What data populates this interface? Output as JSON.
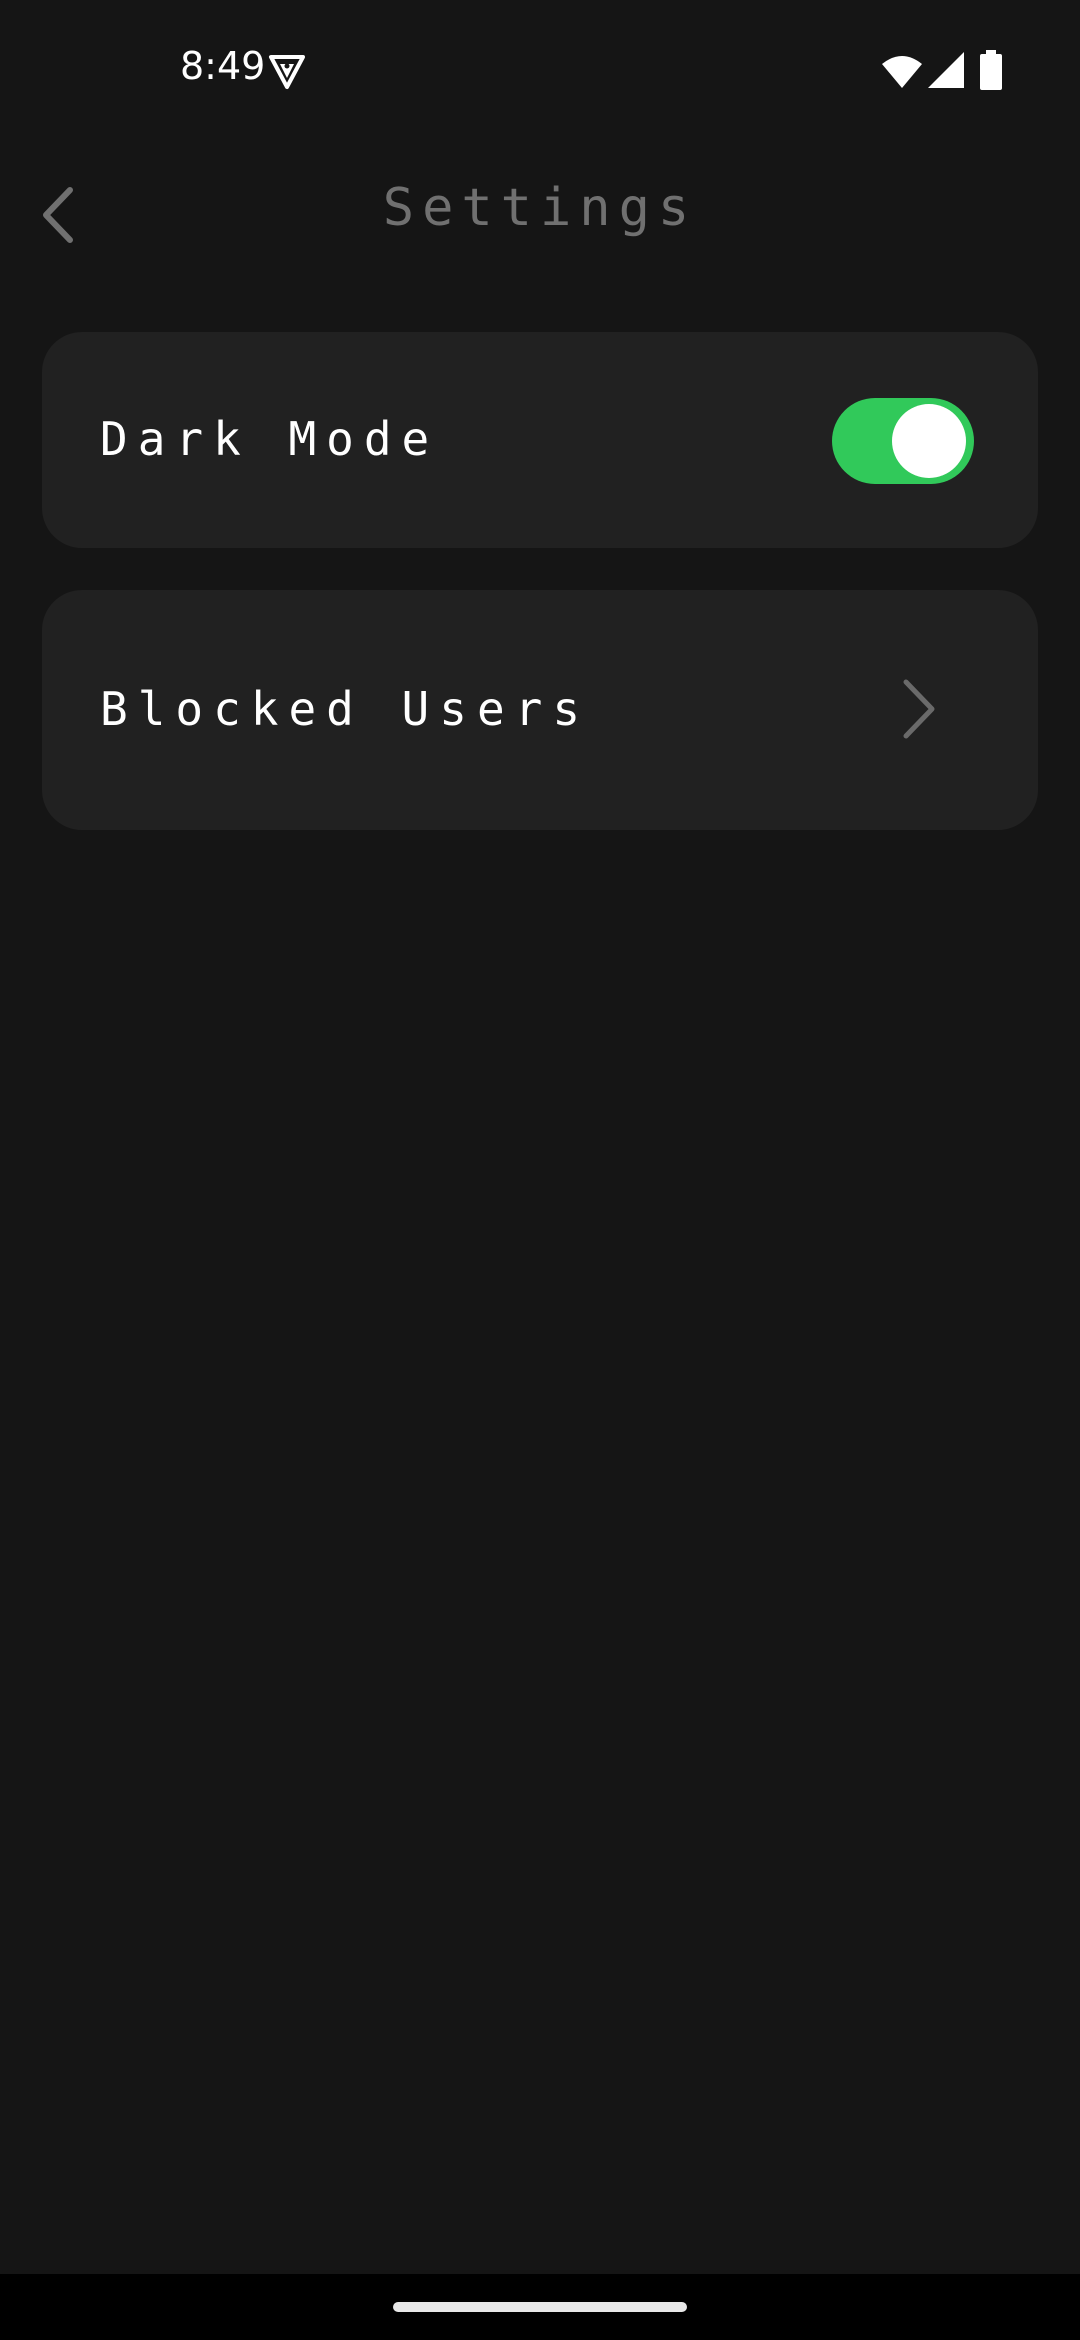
{
  "status_bar": {
    "time": "8:49",
    "icons": [
      "vpn-icon",
      "wifi-icon",
      "cell-signal-icon",
      "battery-icon"
    ]
  },
  "header": {
    "title": "Settings",
    "back_icon": "chevron-left-icon"
  },
  "settings": {
    "dark_mode": {
      "label": "Dark Mode",
      "enabled": true,
      "toggle_color": "#31c95a"
    },
    "blocked_users": {
      "label": "Blocked Users",
      "icon": "chevron-right-icon"
    }
  },
  "colors": {
    "background": "#151515",
    "card": "#212121",
    "title": "#707070",
    "text": "#ffffff",
    "accent": "#31c95a"
  }
}
